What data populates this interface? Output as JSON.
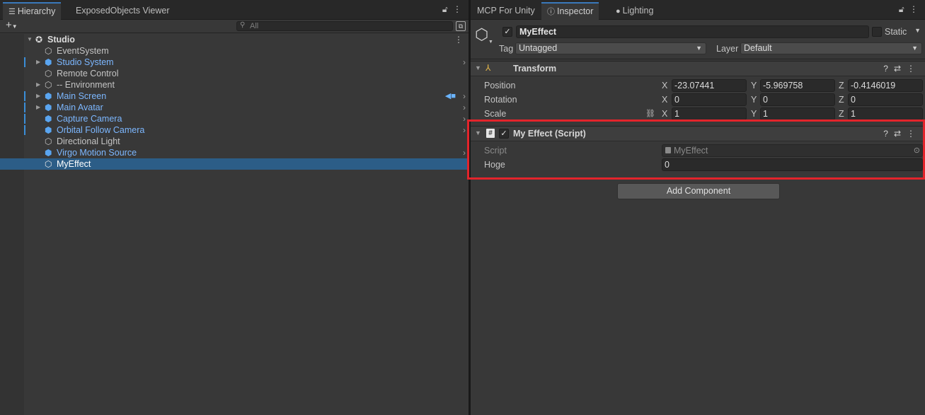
{
  "hierarchy_panel": {
    "tabs": [
      {
        "label": "Hierarchy",
        "icon": "list-icon"
      },
      {
        "label": "ExposedObjects Viewer"
      }
    ],
    "search_placeholder": "All",
    "add_button": "+",
    "scene": "Studio",
    "items": [
      {
        "label": "EventSystem",
        "color": "#c4c4c4"
      },
      {
        "label": "Studio System",
        "color": "#7cb7ff"
      },
      {
        "label": "Remote Control",
        "color": "#c4c4c4"
      },
      {
        "label": "-- Environment",
        "color": "#c4c4c4"
      },
      {
        "label": "Main Screen",
        "color": "#7cb7ff"
      },
      {
        "label": "Main Avatar",
        "color": "#7cb7ff"
      },
      {
        "label": "Capture Camera",
        "color": "#7cb7ff"
      },
      {
        "label": "Orbital Follow Camera",
        "color": "#7cb7ff"
      },
      {
        "label": "Directional Light",
        "color": "#c4c4c4"
      },
      {
        "label": "Virgo Motion Source",
        "color": "#7cb7ff"
      },
      {
        "label": "MyEffect",
        "color": "#ffffff",
        "selected": true
      }
    ]
  },
  "inspector_panel": {
    "tabs": [
      {
        "label": "MCP For Unity"
      },
      {
        "label": "Inspector",
        "icon": "info-icon"
      },
      {
        "label": "Lighting",
        "icon": "bulb-icon"
      }
    ],
    "object_name": "MyEffect",
    "static_label": "Static",
    "tag_label": "Tag",
    "tag_value": "Untagged",
    "layer_label": "Layer",
    "layer_value": "Default",
    "transform": {
      "title": "Transform",
      "position_label": "Position",
      "rotation_label": "Rotation",
      "scale_label": "Scale",
      "axis_x": "X",
      "axis_y": "Y",
      "axis_z": "Z",
      "position": {
        "x": "-23.07441",
        "y": "-5.969758",
        "z": "-0.4146019"
      },
      "rotation": {
        "x": "0",
        "y": "0",
        "z": "0"
      },
      "scale": {
        "x": "1",
        "y": "1",
        "z": "1"
      }
    },
    "script_component": {
      "title": "My Effect (Script)",
      "script_label": "Script",
      "script_value": "MyEffect",
      "hoge_label": "Hoge",
      "hoge_value": "0"
    },
    "add_component_label": "Add Component"
  },
  "colors": {
    "highlight_box": "#e3242b",
    "selection": "#2c5d87",
    "prefab_blue": "#7cb7ff"
  }
}
